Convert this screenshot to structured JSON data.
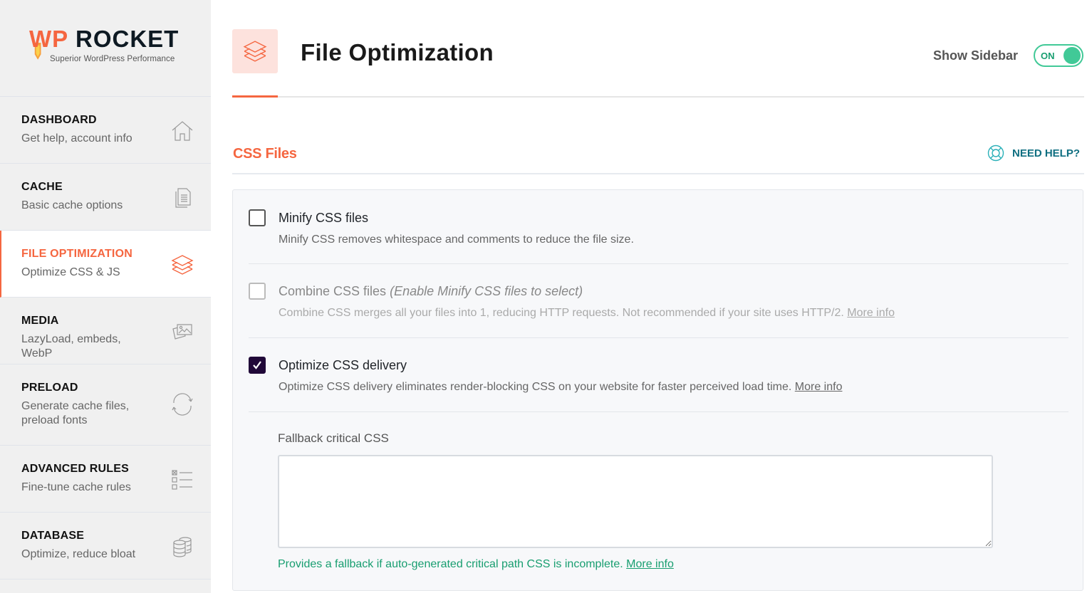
{
  "brand": {
    "name_left": "WP",
    "name_right": "ROCKET",
    "tagline": "Superior WordPress Performance",
    "accent_color": "#f56640"
  },
  "sidebar": {
    "items": [
      {
        "title": "DASHBOARD",
        "subtitle": "Get help, account info",
        "icon": "home-icon",
        "active": false
      },
      {
        "title": "CACHE",
        "subtitle": "Basic cache options",
        "icon": "document-icon",
        "active": false
      },
      {
        "title": "FILE OPTIMIZATION",
        "subtitle": "Optimize CSS & JS",
        "icon": "layers-icon",
        "active": true
      },
      {
        "title": "MEDIA",
        "subtitle": "LazyLoad, embeds, WebP",
        "icon": "images-icon",
        "active": false
      },
      {
        "title": "PRELOAD",
        "subtitle": "Generate cache files, preload fonts",
        "icon": "refresh-icon",
        "active": false
      },
      {
        "title": "ADVANCED RULES",
        "subtitle": "Fine-tune cache rules",
        "icon": "checklist-icon",
        "active": false
      },
      {
        "title": "DATABASE",
        "subtitle": "Optimize, reduce bloat",
        "icon": "database-icon",
        "active": false
      }
    ]
  },
  "header": {
    "title": "File Optimization",
    "icon": "layers-icon",
    "show_sidebar_label": "Show Sidebar",
    "toggle_state": "ON"
  },
  "section": {
    "title": "CSS Files",
    "help_label": "NEED HELP?",
    "help_icon": "lifebuoy-icon"
  },
  "fields": [
    {
      "label": "Minify CSS files",
      "hint": "",
      "description": "Minify CSS removes whitespace and comments to reduce the file size.",
      "link": "",
      "checked": false,
      "disabled": false
    },
    {
      "label": "Combine CSS files",
      "hint": "(Enable Minify CSS files to select)",
      "description": "Combine CSS merges all your files into 1, reducing HTTP requests. Not recommended if your site uses HTTP/2.",
      "link": "More info",
      "checked": false,
      "disabled": true
    },
    {
      "label": "Optimize CSS delivery",
      "hint": "",
      "description": "Optimize CSS delivery eliminates render-blocking CSS on your website for faster perceived load time.",
      "link": "More info",
      "checked": true,
      "disabled": false
    }
  ],
  "fallback": {
    "label": "Fallback critical CSS",
    "value": "",
    "help_text": "Provides a fallback if auto-generated critical path CSS is incomplete.",
    "help_link": "More info",
    "help_color": "#189e70"
  }
}
